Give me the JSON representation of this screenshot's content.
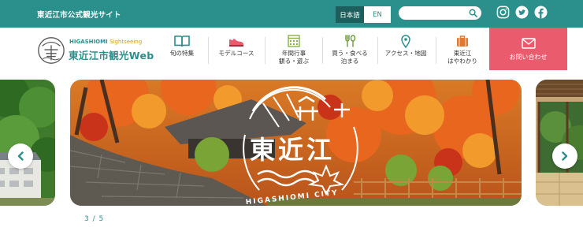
{
  "colors": {
    "brand": "#2b8f8b",
    "brand_dark": "#1d5f5c",
    "contact": "#ea5b6e",
    "accent": "#c9a227"
  },
  "topbar": {
    "site_label": "東近江市公式観光サイト",
    "lang_ja": "日本語",
    "lang_en": "EN",
    "search_placeholder": "",
    "social": [
      "instagram-icon",
      "twitter-icon",
      "facebook-icon"
    ]
  },
  "logo": {
    "sub_en": "HIGASHIOMI",
    "sub_accent": "Sightseeing",
    "main": "東近江市観光Web"
  },
  "nav": {
    "items": [
      {
        "label": "旬の特集",
        "icon": "book-icon"
      },
      {
        "label": "モデルコース",
        "icon": "shoe-icon"
      },
      {
        "label": "年間行事\n観る・遊ぶ",
        "icon": "calendar-icon"
      },
      {
        "label": "買う・食べる\n泊まる",
        "icon": "utensils-icon"
      },
      {
        "label": "アクセス・地図",
        "icon": "map-pin-icon"
      },
      {
        "label": "東近江\nはやわかり",
        "icon": "suitcase-icon"
      }
    ],
    "contact": {
      "label": "お問い合わせ",
      "icon": "mail-icon"
    }
  },
  "hero": {
    "logo_kanji": "東近江",
    "logo_roman": "HIGASHIOMI CITY",
    "counter": "3 / 5"
  }
}
